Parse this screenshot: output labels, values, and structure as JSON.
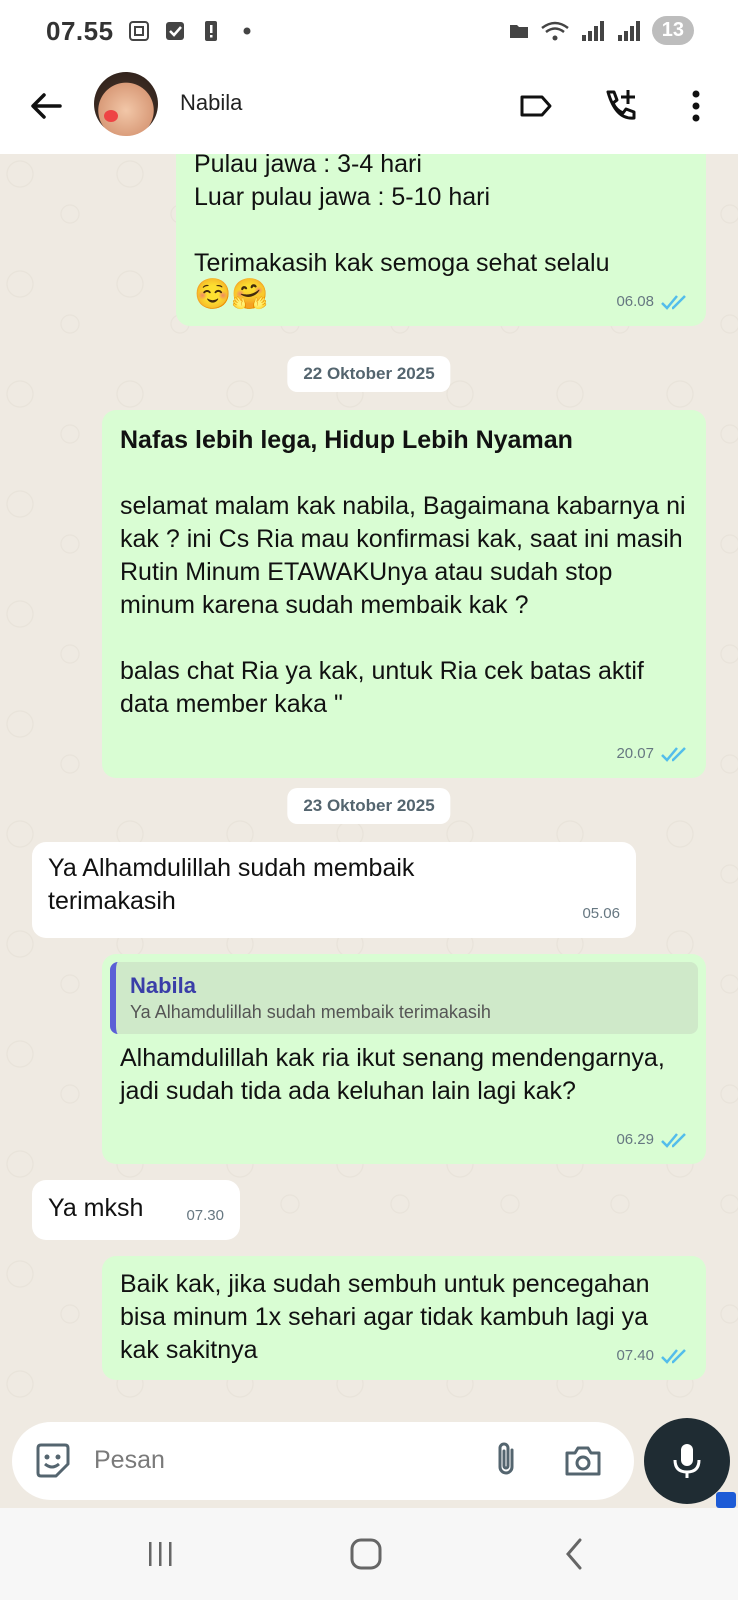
{
  "status_bar": {
    "time": "07.55",
    "badge": "13"
  },
  "header": {
    "contact_name": "Nabila"
  },
  "messages": [
    {
      "dir": "out",
      "text": "Pulau jawa : 3-4 hari\nLuar pulau jawa : 5-10 hari\n\nTerimakasih kak semoga sehat selalu",
      "emoji": "☺️🤗",
      "time": "06.08"
    },
    {
      "date": "22 Oktober 2025"
    },
    {
      "dir": "out",
      "title": "Nafas lebih lega, Hidup Lebih Nyaman",
      "text": "selamat malam kak nabila,  Bagaimana kabarnya ni kak ? ini Cs Ria mau konfirmasi kak, saat ini masih Rutin Minum ETAWAKUnya atau sudah stop minum karena sudah membaik kak ?\n\nbalas chat Ria ya kak, untuk Ria cek batas aktif data member kaka \"",
      "time": "20.07"
    },
    {
      "date": "23 Oktober 2025"
    },
    {
      "dir": "in",
      "text": "Ya Alhamdulillah sudah membaik terimakasih",
      "time": "05.06"
    },
    {
      "dir": "out",
      "quote_name": "Nabila",
      "quote_text": "Ya Alhamdulillah sudah membaik terimakasih",
      "text": "Alhamdulillah kak ria ikut senang mendengarnya, jadi sudah tida ada keluhan lain lagi kak?",
      "time": "06.29"
    },
    {
      "dir": "in",
      "text": "Ya mksh",
      "time": "07.30"
    },
    {
      "dir": "out",
      "text": "Baik kak, jika sudah sembuh untuk pencegahan bisa minum 1x sehari agar tidak kambuh lagi ya kak sakitnya",
      "time": "07.40"
    }
  ],
  "input": {
    "placeholder": "Pesan"
  },
  "colors": {
    "outgoing": "#d9fdd3",
    "incoming": "#ffffff",
    "chat_bg": "#efeae2",
    "tick_read": "#53bdeb",
    "mic_bg": "#1f2c33"
  },
  "icons": [
    "back-arrow-icon",
    "label-icon",
    "add-call-icon",
    "more-vert-icon",
    "sticker-icon",
    "attach-icon",
    "camera-icon",
    "mic-icon"
  ]
}
